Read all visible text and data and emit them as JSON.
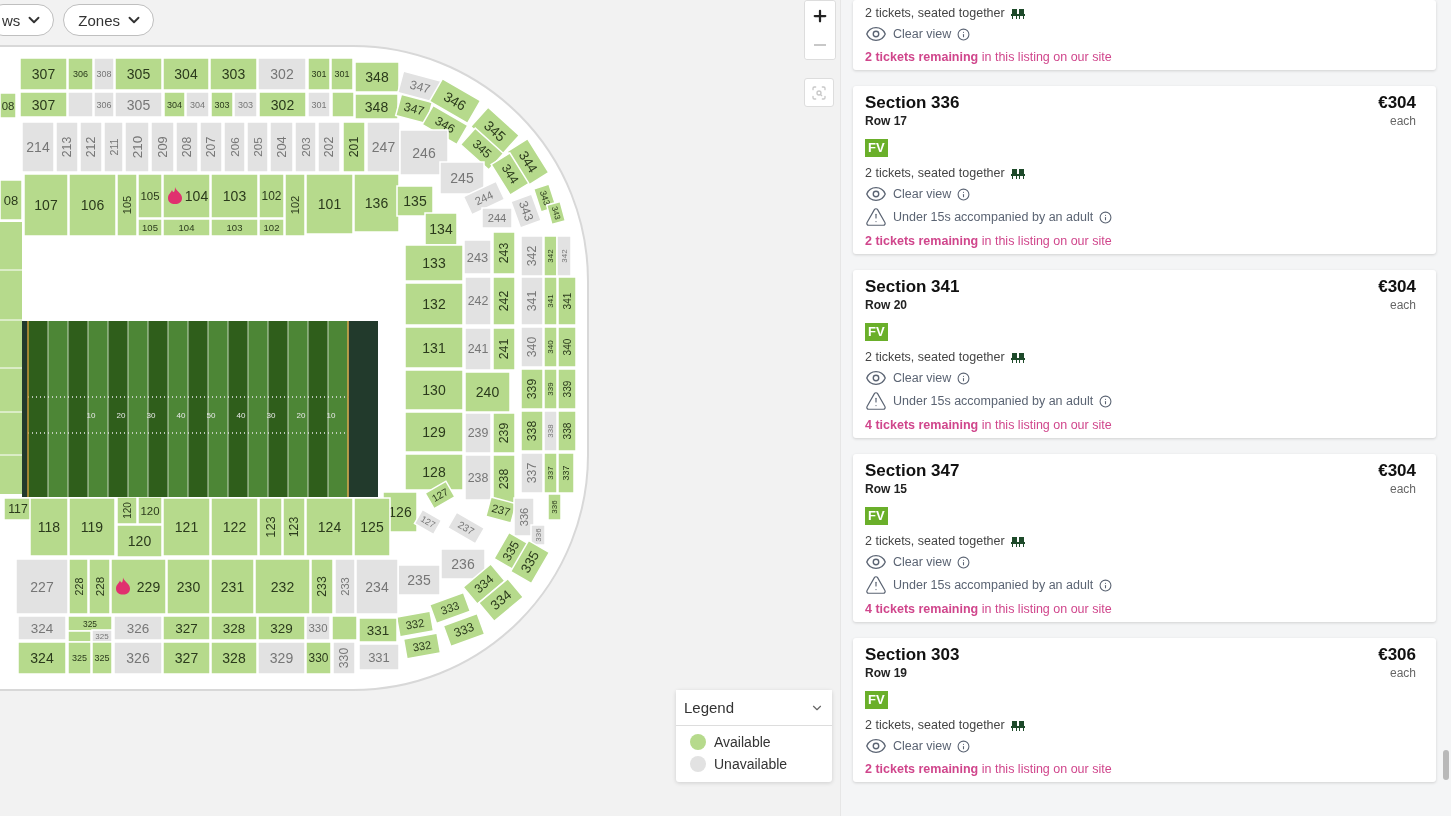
{
  "filters": [
    {
      "label": "ws"
    },
    {
      "label": "Zones"
    }
  ],
  "map_controls": {
    "zoom_out": {
      "disabled": true
    }
  },
  "map": {
    "yard_numbers": [
      "10",
      "20",
      "30",
      "40",
      "50",
      "40",
      "30",
      "20",
      "10"
    ],
    "sections": [
      {
        "label": "08",
        "available": true,
        "hot": false
      },
      {
        "label": "307",
        "available": true,
        "hot": false
      },
      {
        "label": "306",
        "available": true,
        "hot": false
      },
      {
        "label": "308",
        "available": false,
        "hot": false
      },
      {
        "label": "305",
        "available": true,
        "hot": false
      },
      {
        "label": "304",
        "available": true,
        "hot": false
      },
      {
        "label": "303",
        "available": true,
        "hot": false
      },
      {
        "label": "302",
        "available": false,
        "hot": false
      },
      {
        "label": "301",
        "available": true,
        "hot": false
      },
      {
        "label": "301",
        "available": true,
        "hot": false
      },
      {
        "label": "348",
        "available": true,
        "hot": false
      },
      {
        "label": "307",
        "available": true,
        "hot": false
      },
      {
        "label": "306",
        "available": false,
        "hot": false
      },
      {
        "label": "305",
        "available": false,
        "hot": false
      },
      {
        "label": "304",
        "available": true,
        "hot": false
      },
      {
        "label": "304",
        "available": false,
        "hot": false
      },
      {
        "label": "303",
        "available": true,
        "hot": false
      },
      {
        "label": "303",
        "available": false,
        "hot": false
      },
      {
        "label": "302",
        "available": true,
        "hot": false
      },
      {
        "label": "301",
        "available": false,
        "hot": false
      },
      {
        "label": "348",
        "available": true,
        "hot": false
      },
      {
        "available": false,
        "hot": false
      },
      {
        "available": true,
        "hot": false
      },
      {
        "label": "214",
        "available": false,
        "hot": false
      },
      {
        "label": "213",
        "available": false,
        "hot": false
      },
      {
        "label": "212",
        "available": false,
        "hot": false
      },
      {
        "label": "211",
        "available": false,
        "hot": false
      },
      {
        "label": "210",
        "available": false,
        "hot": false
      },
      {
        "label": "209",
        "available": false,
        "hot": false
      },
      {
        "label": "208",
        "available": false,
        "hot": false
      },
      {
        "label": "207",
        "available": false,
        "hot": false
      },
      {
        "label": "206",
        "available": false,
        "hot": false
      },
      {
        "label": "205",
        "available": false,
        "hot": false
      },
      {
        "label": "204",
        "available": false,
        "hot": false
      },
      {
        "label": "203",
        "available": false,
        "hot": false
      },
      {
        "label": "202",
        "available": false,
        "hot": false
      },
      {
        "label": "201",
        "available": true,
        "hot": false
      },
      {
        "label": "247",
        "available": false,
        "hot": false
      },
      {
        "label": "08",
        "available": true,
        "hot": false
      },
      {
        "label": "107",
        "available": true,
        "hot": false
      },
      {
        "label": "106",
        "available": true,
        "hot": false
      },
      {
        "label": "105",
        "available": true,
        "hot": false
      },
      {
        "label": "105",
        "available": true,
        "hot": false
      },
      {
        "label": "104",
        "available": true,
        "hot": true
      },
      {
        "label": "103",
        "available": true,
        "hot": false
      },
      {
        "label": "102",
        "available": true,
        "hot": false
      },
      {
        "label": "102",
        "available": true,
        "hot": false
      },
      {
        "label": "101",
        "available": true,
        "hot": false
      },
      {
        "label": "136",
        "available": true,
        "hot": false
      },
      {
        "label": "105",
        "available": true,
        "hot": false
      },
      {
        "label": "104",
        "available": true,
        "hot": false
      },
      {
        "label": "103",
        "available": true,
        "hot": false
      },
      {
        "label": "102",
        "available": true,
        "hot": false
      },
      {
        "label": "347",
        "available": false,
        "hot": false
      },
      {
        "label": "347",
        "available": true,
        "hot": false
      },
      {
        "label": "346",
        "available": true,
        "hot": false
      },
      {
        "label": "346",
        "available": true,
        "hot": false
      },
      {
        "label": "345",
        "available": true,
        "hot": false
      },
      {
        "label": "345",
        "available": true,
        "hot": false
      },
      {
        "label": "344",
        "available": true,
        "hot": false
      },
      {
        "label": "344",
        "available": true,
        "hot": false
      },
      {
        "label": "343",
        "available": true,
        "hot": false
      },
      {
        "label": "343",
        "available": false,
        "hot": false
      },
      {
        "label": "343",
        "available": true,
        "hot": false
      },
      {
        "label": "246",
        "available": false,
        "hot": false
      },
      {
        "label": "245",
        "available": false,
        "hot": false
      },
      {
        "label": "244",
        "available": false,
        "hot": false
      },
      {
        "label": "244",
        "available": false,
        "hot": false
      },
      {
        "label": "135",
        "available": true,
        "hot": false
      },
      {
        "label": "134",
        "available": true,
        "hot": false
      },
      {
        "label": "243",
        "available": false,
        "hot": false
      },
      {
        "label": "243",
        "available": true,
        "hot": false
      },
      {
        "label": "342",
        "available": false,
        "hot": false
      },
      {
        "label": "342",
        "available": true,
        "hot": false
      },
      {
        "label": "342",
        "available": false,
        "hot": false
      },
      {
        "label": "133",
        "available": true,
        "hot": false
      },
      {
        "label": "132",
        "available": true,
        "hot": false
      },
      {
        "label": "131",
        "available": true,
        "hot": false
      },
      {
        "label": "130",
        "available": true,
        "hot": false
      },
      {
        "label": "129",
        "available": true,
        "hot": false
      },
      {
        "label": "128",
        "available": true,
        "hot": false
      },
      {
        "label": "242",
        "available": false,
        "hot": false
      },
      {
        "label": "242",
        "available": true,
        "hot": false
      },
      {
        "label": "341",
        "available": false,
        "hot": false
      },
      {
        "label": "341",
        "available": true,
        "hot": false
      },
      {
        "label": "341",
        "available": true,
        "hot": false
      },
      {
        "label": "241",
        "available": false,
        "hot": false
      },
      {
        "label": "241",
        "available": true,
        "hot": false
      },
      {
        "label": "340",
        "available": false,
        "hot": false
      },
      {
        "label": "340",
        "available": true,
        "hot": false
      },
      {
        "label": "340",
        "available": true,
        "hot": false
      },
      {
        "label": "240",
        "available": true,
        "hot": false
      },
      {
        "label": "339",
        "available": true,
        "hot": false
      },
      {
        "label": "339",
        "available": true,
        "hot": false
      },
      {
        "label": "339",
        "available": true,
        "hot": false
      },
      {
        "label": "239",
        "available": false,
        "hot": false
      },
      {
        "label": "239",
        "available": true,
        "hot": false
      },
      {
        "label": "338",
        "available": true,
        "hot": false
      },
      {
        "label": "338",
        "available": false,
        "hot": false
      },
      {
        "label": "338",
        "available": true,
        "hot": false
      },
      {
        "label": "238",
        "available": false,
        "hot": false
      },
      {
        "label": "238",
        "available": true,
        "hot": false
      },
      {
        "label": "337",
        "available": false,
        "hot": false
      },
      {
        "label": "337",
        "available": true,
        "hot": false
      },
      {
        "label": "337",
        "available": true,
        "hot": false
      },
      {
        "label": "127",
        "available": true,
        "hot": false
      },
      {
        "label": "126",
        "available": true,
        "hot": false
      },
      {
        "label": "127",
        "available": false,
        "hot": false
      },
      {
        "label": "237",
        "available": true,
        "hot": false
      },
      {
        "label": "237",
        "available": false,
        "hot": false
      },
      {
        "label": "336",
        "available": false,
        "hot": false
      },
      {
        "label": "336",
        "available": true,
        "hot": false
      },
      {
        "label": "336",
        "available": false,
        "hot": false
      },
      {
        "label": "236",
        "available": false,
        "hot": false
      },
      {
        "label": "235",
        "available": false,
        "hot": false
      },
      {
        "label": "335",
        "available": true,
        "hot": false
      },
      {
        "label": "335",
        "available": true,
        "hot": false
      },
      {
        "label": "334",
        "available": true,
        "hot": false
      },
      {
        "label": "334",
        "available": true,
        "hot": false
      },
      {
        "label": "333",
        "available": true,
        "hot": false
      },
      {
        "label": "333",
        "available": true,
        "hot": false
      },
      {
        "label": "332",
        "available": true,
        "hot": false
      },
      {
        "label": "332",
        "available": true,
        "hot": false
      },
      {
        "label": "331",
        "available": true,
        "hot": false
      },
      {
        "label": "331",
        "available": false,
        "hot": false
      },
      {
        "label": "117",
        "available": true,
        "hot": false
      },
      {
        "label": "118",
        "available": true,
        "hot": false
      },
      {
        "label": "119",
        "available": true,
        "hot": false
      },
      {
        "label": "120",
        "available": true,
        "hot": false
      },
      {
        "label": "120",
        "available": true,
        "hot": false
      },
      {
        "label": "120",
        "available": true,
        "hot": false
      },
      {
        "label": "121",
        "available": true,
        "hot": false
      },
      {
        "label": "122",
        "available": true,
        "hot": false
      },
      {
        "label": "123",
        "available": true,
        "hot": false
      },
      {
        "label": "123",
        "available": true,
        "hot": false
      },
      {
        "label": "124",
        "available": true,
        "hot": false
      },
      {
        "label": "125",
        "available": true,
        "hot": false
      },
      {
        "label": "227",
        "available": false,
        "hot": false
      },
      {
        "label": "228",
        "available": true,
        "hot": false
      },
      {
        "label": "228",
        "available": true,
        "hot": false
      },
      {
        "label": "229",
        "available": true,
        "hot": true
      },
      {
        "label": "230",
        "available": true,
        "hot": false
      },
      {
        "label": "231",
        "available": true,
        "hot": false
      },
      {
        "label": "232",
        "available": true,
        "hot": false
      },
      {
        "label": "233",
        "available": true,
        "hot": false
      },
      {
        "label": "233",
        "available": false,
        "hot": false
      },
      {
        "label": "234",
        "available": false,
        "hot": false
      },
      {
        "label": "324",
        "available": false,
        "hot": false
      },
      {
        "label": "325",
        "available": true,
        "hot": false
      },
      {
        "label": "325",
        "available": false,
        "hot": false
      },
      {
        "available": true,
        "hot": false
      },
      {
        "label": "326",
        "available": false,
        "hot": false
      },
      {
        "label": "327",
        "available": true,
        "hot": false
      },
      {
        "label": "328",
        "available": true,
        "hot": false
      },
      {
        "label": "329",
        "available": true,
        "hot": false
      },
      {
        "label": "330",
        "available": false,
        "hot": false
      },
      {
        "available": true,
        "hot": false
      },
      {
        "label": "324",
        "available": true,
        "hot": false
      },
      {
        "label": "325",
        "available": true,
        "hot": false
      },
      {
        "label": "325",
        "available": true,
        "hot": false
      },
      {
        "label": "326",
        "available": false,
        "hot": false
      },
      {
        "label": "327",
        "available": true,
        "hot": false
      },
      {
        "label": "328",
        "available": true,
        "hot": false
      },
      {
        "label": "329",
        "available": false,
        "hot": false
      },
      {
        "label": "330",
        "available": true,
        "hot": false
      },
      {
        "label": "330",
        "available": false,
        "hot": false
      }
    ]
  },
  "legend": {
    "title": "Legend",
    "items": [
      {
        "label": "Available",
        "color": "#b6da8c"
      },
      {
        "label": "Unavailable",
        "color": "#e2e2e2"
      }
    ]
  },
  "listings": [
    {
      "features": [
        {
          "kind": "seats",
          "text": "2 tickets, seated together"
        },
        {
          "kind": "view",
          "text": "Clear view"
        }
      ],
      "remaining": "**2 tickets remaining** in this listing on our site"
    },
    {
      "section": "Section 336",
      "row": "Row 17",
      "price": "€304",
      "price_unit": "each",
      "badge": "FV",
      "features": [
        {
          "kind": "seats",
          "text": "2 tickets, seated together"
        },
        {
          "kind": "view",
          "text": "Clear view"
        },
        {
          "kind": "age",
          "text": "Under 15s accompanied by an adult"
        }
      ],
      "remaining": "**2 tickets remaining** in this listing on our site"
    },
    {
      "section": "Section 341",
      "row": "Row 20",
      "price": "€304",
      "price_unit": "each",
      "badge": "FV",
      "features": [
        {
          "kind": "seats",
          "text": "2 tickets, seated together"
        },
        {
          "kind": "view",
          "text": "Clear view"
        },
        {
          "kind": "age",
          "text": "Under 15s accompanied by an adult"
        }
      ],
      "remaining": "**4 tickets remaining** in this listing on our site"
    },
    {
      "section": "Section 347",
      "row": "Row 15",
      "price": "€304",
      "price_unit": "each",
      "badge": "FV",
      "features": [
        {
          "kind": "seats",
          "text": "2 tickets, seated together"
        },
        {
          "kind": "view",
          "text": "Clear view"
        },
        {
          "kind": "age",
          "text": "Under 15s accompanied by an adult"
        }
      ],
      "remaining": "**4 tickets remaining** in this listing on our site"
    },
    {
      "section": "Section 303",
      "row": "Row 19",
      "price": "€306",
      "price_unit": "each",
      "badge": "FV",
      "features": [
        {
          "kind": "seats",
          "text": "2 tickets, seated together"
        },
        {
          "kind": "view",
          "text": "Clear view"
        }
      ],
      "remaining": "**2 tickets remaining** in this listing on our site"
    }
  ]
}
